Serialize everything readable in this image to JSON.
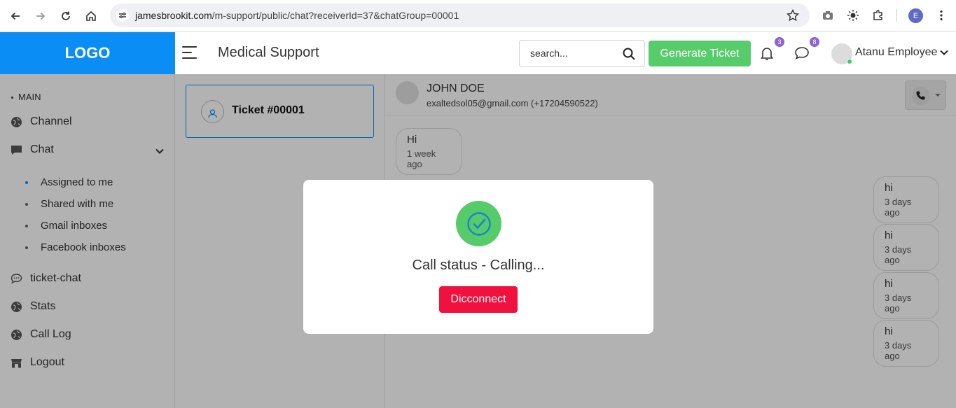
{
  "browser": {
    "url_host": "jamesbrookit.com",
    "url_path": "/m-support/public/chat?receiverId=37&chatGroup=00001",
    "profile_initial": "E"
  },
  "header": {
    "logo": "LOGO",
    "title": "Medical Support",
    "search_placeholder": "search...",
    "generate_ticket_label": "Generate Ticket",
    "notifications_count": "3",
    "messages_count": "8",
    "user_name": "Atanu Employee"
  },
  "sidebar": {
    "section_label": "MAIN",
    "items": [
      {
        "label": "Channel",
        "icon": "globe-icon"
      },
      {
        "label": "Chat",
        "icon": "chat-bubble-icon"
      },
      {
        "label": "ticket-chat",
        "icon": "speech-icon"
      },
      {
        "label": "Stats",
        "icon": "globe-icon"
      },
      {
        "label": "Call Log",
        "icon": "globe-icon"
      },
      {
        "label": "Logout",
        "icon": "store-icon"
      }
    ],
    "chat_subitems": [
      "Assigned to me",
      "Shared with me",
      "Gmail inboxes",
      "Facebook inboxes"
    ]
  },
  "tickets": [
    {
      "label": "Ticket #00001"
    }
  ],
  "chat": {
    "contact_name": "JOHN DOE",
    "contact_detail": "exaltedsol05@gmail.com (+17204590522)",
    "messages": [
      {
        "text": "Hi",
        "time": "1 week ago",
        "side": "left"
      },
      {
        "text": "hi",
        "time": "3 days ago",
        "side": "right"
      },
      {
        "text": "hi",
        "time": "3 days ago",
        "side": "right"
      },
      {
        "text": "hi",
        "time": "3 days ago",
        "side": "right"
      },
      {
        "text": "hi",
        "time": "3 days ago",
        "side": "right"
      }
    ]
  },
  "modal": {
    "status_text": "Call status - Calling...",
    "disconnect_label": "Dicconnect"
  },
  "colors": {
    "brand_blue": "#0a8ef5",
    "success_green": "#57cc6b",
    "danger_red": "#f0113f",
    "badge_purple": "#8c64d6"
  }
}
